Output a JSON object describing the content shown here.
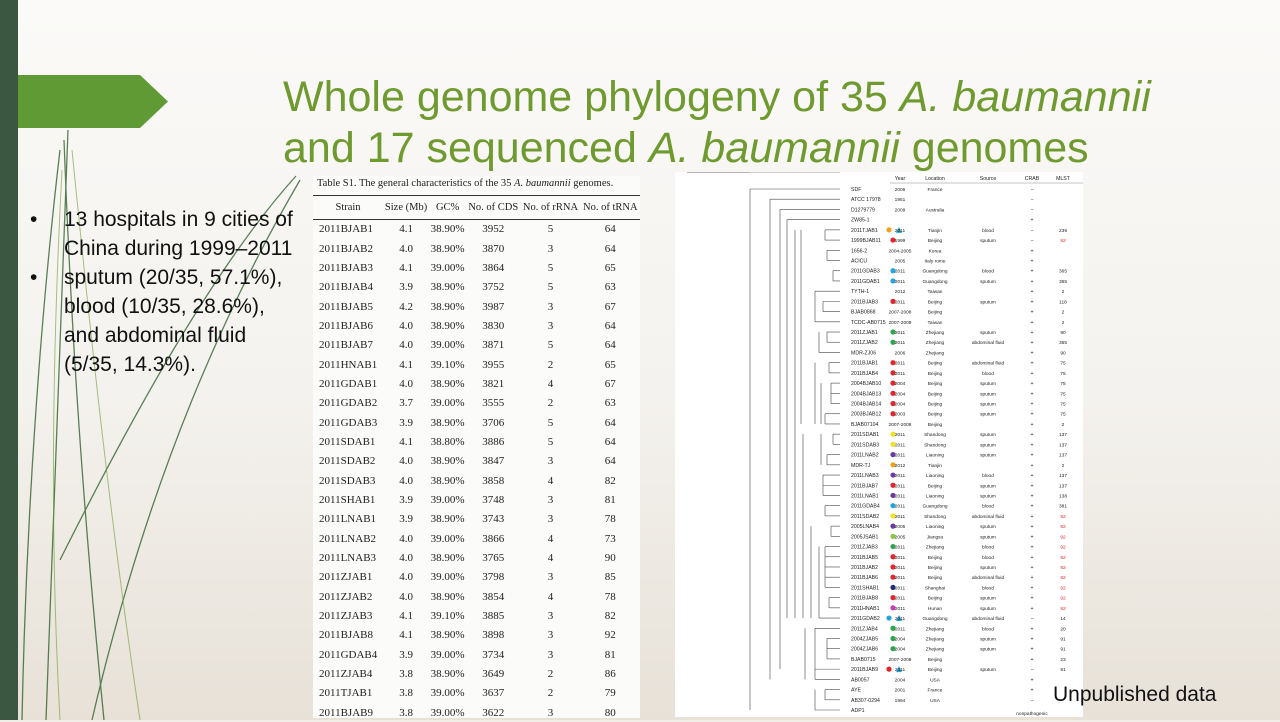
{
  "slide": {
    "title": {
      "line1_prefix": "Whole genome phylogeny of 35 ",
      "line1_genus": "A. ",
      "line1_species": "baumannii",
      "line2_prefix": "and 17 sequenced ",
      "line2_genus": "A. ",
      "line2_species": "baumannii",
      "line2_suffix": " genomes"
    },
    "bullets": [
      "13 hospitals in 9 cities of China during 1999–2011",
      "sputum (20/35, 57.1%), blood (10/35, 28.6%), and abdominal fluid (5/35, 14.3%)."
    ],
    "footnote": "Unpublished data",
    "colors": {
      "title": "#6f9a2f",
      "arrow": "#5f9a35",
      "sidebar": "#3b5742"
    }
  },
  "table": {
    "caption_prefix": "Table S1. The general characteristics of the 35 ",
    "caption_italic": "A. baumannii",
    "caption_suffix": " genomes.",
    "headers": [
      "Strain",
      "Size (Mb)",
      "GC%",
      "No. of CDS",
      "No. of rRNA",
      "No. of tRNA"
    ],
    "rows": [
      [
        "2011BJAB1",
        "4.1",
        "38.90%",
        "3952",
        "5",
        "64"
      ],
      [
        "2011BJAB2",
        "4.0",
        "38.90%",
        "3870",
        "3",
        "64"
      ],
      [
        "2011BJAB3",
        "4.1",
        "39.00%",
        "3864",
        "5",
        "65"
      ],
      [
        "2011BJAB4",
        "3.9",
        "38.90%",
        "3752",
        "5",
        "63"
      ],
      [
        "2011BJAB5",
        "4.2",
        "38.90%",
        "3987",
        "3",
        "67"
      ],
      [
        "2011BJAB6",
        "4.0",
        "38.90%",
        "3830",
        "3",
        "64"
      ],
      [
        "2011BJAB7",
        "4.0",
        "39.00%",
        "3871",
        "5",
        "64"
      ],
      [
        "2011HNAB1",
        "4.1",
        "39.10%",
        "3955",
        "2",
        "65"
      ],
      [
        "2011GDAB1",
        "4.0",
        "38.90%",
        "3821",
        "4",
        "67"
      ],
      [
        "2011GDAB2",
        "3.7",
        "39.00%",
        "3555",
        "2",
        "63"
      ],
      [
        "2011GDAB3",
        "3.9",
        "38.90%",
        "3706",
        "5",
        "64"
      ],
      [
        "2011SDAB1",
        "4.1",
        "38.80%",
        "3886",
        "5",
        "64"
      ],
      [
        "2011SDAB2",
        "4.0",
        "38.90%",
        "3847",
        "3",
        "64"
      ],
      [
        "2011SDAB3",
        "4.0",
        "38.90%",
        "3858",
        "4",
        "82"
      ],
      [
        "2011SHAB1",
        "3.9",
        "39.00%",
        "3748",
        "3",
        "81"
      ],
      [
        "2011LNAB1",
        "3.9",
        "38.90%",
        "3743",
        "3",
        "78"
      ],
      [
        "2011LNAB2",
        "4.0",
        "39.00%",
        "3866",
        "4",
        "73"
      ],
      [
        "2011LNAB3",
        "4.0",
        "38.90%",
        "3765",
        "4",
        "90"
      ],
      [
        "2011ZJAB1",
        "4.0",
        "39.00%",
        "3798",
        "3",
        "85"
      ],
      [
        "2011ZJAB2",
        "4.0",
        "38.90%",
        "3854",
        "4",
        "78"
      ],
      [
        "2011ZJAB3",
        "4.1",
        "39.10%",
        "3885",
        "3",
        "82"
      ],
      [
        "2011BJAB8",
        "4.1",
        "38.90%",
        "3898",
        "3",
        "92"
      ],
      [
        "2011GDAB4",
        "3.9",
        "39.00%",
        "3734",
        "3",
        "81"
      ],
      [
        "2011ZJAB4",
        "3.8",
        "38.90%",
        "3649",
        "2",
        "86"
      ],
      [
        "2011TJAB1",
        "3.8",
        "39.00%",
        "3637",
        "2",
        "79"
      ],
      [
        "2011BJAB9",
        "3.8",
        "39.00%",
        "3622",
        "3",
        "80"
      ]
    ]
  },
  "tree": {
    "headers": [
      "Year",
      "Location",
      "Source",
      "CRAB",
      "MLST"
    ],
    "footer_label": "nonpathogenic",
    "colors": {
      "red": "#e0262b",
      "blue": "#27a2dc",
      "green": "#2ea44b",
      "yellow": "#f2e022",
      "orange": "#f2a21a",
      "purple": "#6b3aa5",
      "navy": "#1f2a78",
      "magenta": "#c93bb8",
      "lime": "#8cc63f",
      "mlst_highlight": "#e0262b"
    },
    "leaves": [
      {
        "name": "SDF",
        "year": "2006",
        "loc": "France",
        "src": "",
        "crab": "−",
        "mlst": "",
        "dot": "",
        "tri": false
      },
      {
        "name": "ATCC 17978",
        "year": "1951",
        "loc": "",
        "src": "",
        "crab": "−",
        "mlst": "",
        "dot": "",
        "tri": false
      },
      {
        "name": "D1279779",
        "year": "2009",
        "loc": "Australia",
        "src": "",
        "crab": "−",
        "mlst": "",
        "dot": "",
        "tri": false
      },
      {
        "name": "ZW85-1",
        "year": "",
        "loc": "",
        "src": "",
        "crab": "+",
        "mlst": "",
        "dot": "",
        "tri": false
      },
      {
        "name": "2011TJAB1",
        "year": "2011",
        "loc": "Tianjin",
        "src": "blood",
        "crab": "−",
        "mlst": "239",
        "dot": "orange",
        "tri": true
      },
      {
        "name": "1999BJAB11",
        "year": "1999",
        "loc": "Beijing",
        "src": "sputum",
        "crab": "−",
        "mlst": "92",
        "dot": "red",
        "tri": false,
        "mlst_red": true
      },
      {
        "name": "1656-2",
        "year": "2004-2005",
        "loc": "Korea",
        "src": "",
        "crab": "+",
        "mlst": "",
        "dot": "",
        "tri": false
      },
      {
        "name": "ACICU",
        "year": "2005",
        "loc": "Italy rome",
        "src": "",
        "crab": "+",
        "mlst": "",
        "dot": "",
        "tri": false
      },
      {
        "name": "2011GDAB3",
        "year": "2011",
        "loc": "Guangdong",
        "src": "blood",
        "crab": "+",
        "mlst": "365",
        "dot": "blue",
        "tri": false
      },
      {
        "name": "2011GDAB1",
        "year": "2011",
        "loc": "Guangdong",
        "src": "sputum",
        "crab": "+",
        "mlst": "365",
        "dot": "blue",
        "tri": false
      },
      {
        "name": "TYTH-1",
        "year": "2012",
        "loc": "Taiwan",
        "src": "",
        "crab": "+",
        "mlst": "2",
        "dot": "",
        "tri": false
      },
      {
        "name": "2011BJAB3",
        "year": "2011",
        "loc": "Beijing",
        "src": "sputum",
        "crab": "+",
        "mlst": "118",
        "dot": "red",
        "tri": false
      },
      {
        "name": "BJAB0868",
        "year": "2007-2008",
        "loc": "Beijing",
        "src": "",
        "crab": "+",
        "mlst": "2",
        "dot": "",
        "tri": false
      },
      {
        "name": "TCDC-AB0715",
        "year": "2007-2009",
        "loc": "Taiwan",
        "src": "",
        "crab": "+",
        "mlst": "2",
        "dot": "",
        "tri": false
      },
      {
        "name": "2011ZJAB1",
        "year": "2011",
        "loc": "Zhejiang",
        "src": "sputum",
        "crab": "+",
        "mlst": "90",
        "dot": "green",
        "tri": false
      },
      {
        "name": "2011ZJAB2",
        "year": "2011",
        "loc": "Zhejiang",
        "src": "abdominal fluid",
        "crab": "+",
        "mlst": "365",
        "dot": "green",
        "tri": false
      },
      {
        "name": "MDR-ZJ06",
        "year": "2006",
        "loc": "Zhejiang",
        "src": "",
        "crab": "+",
        "mlst": "90",
        "dot": "",
        "tri": false
      },
      {
        "name": "2011BJAB1",
        "year": "2011",
        "loc": "Beijing",
        "src": "abdominal fluid",
        "crab": "+",
        "mlst": "75",
        "dot": "red",
        "tri": false
      },
      {
        "name": "2011BJAB4",
        "year": "2011",
        "loc": "Beijing",
        "src": "blood",
        "crab": "+",
        "mlst": "75",
        "dot": "red",
        "tri": false
      },
      {
        "name": "2004BJAB10",
        "year": "2004",
        "loc": "Beijing",
        "src": "sputum",
        "crab": "+",
        "mlst": "75",
        "dot": "red",
        "tri": false
      },
      {
        "name": "2004BJAB13",
        "year": "2004",
        "loc": "Beijing",
        "src": "sputum",
        "crab": "+",
        "mlst": "75",
        "dot": "red",
        "tri": false
      },
      {
        "name": "2004BJAB14",
        "year": "2004",
        "loc": "Beijing",
        "src": "sputum",
        "crab": "+",
        "mlst": "75",
        "dot": "red",
        "tri": false
      },
      {
        "name": "2003BJAB12",
        "year": "2003",
        "loc": "Beijing",
        "src": "sputum",
        "crab": "+",
        "mlst": "75",
        "dot": "red",
        "tri": false
      },
      {
        "name": "BJAB07104",
        "year": "2007-2008",
        "loc": "Beijing",
        "src": "",
        "crab": "+",
        "mlst": "2",
        "dot": "",
        "tri": false
      },
      {
        "name": "2011SDAB1",
        "year": "2011",
        "loc": "Shandong",
        "src": "sputum",
        "crab": "+",
        "mlst": "137",
        "dot": "yellow",
        "tri": false
      },
      {
        "name": "2011SDAB3",
        "year": "2011",
        "loc": "Shandong",
        "src": "sputum",
        "crab": "+",
        "mlst": "137",
        "dot": "yellow",
        "tri": false
      },
      {
        "name": "2011LNAB2",
        "year": "2011",
        "loc": "Liaoning",
        "src": "sputum",
        "crab": "+",
        "mlst": "137",
        "dot": "purple",
        "tri": false
      },
      {
        "name": "MDR-TJ",
        "year": "2012",
        "loc": "Tianjin",
        "src": "",
        "crab": "+",
        "mlst": "2",
        "dot": "orange",
        "tri": false
      },
      {
        "name": "2011LNAB3",
        "year": "2011",
        "loc": "Liaoning",
        "src": "blood",
        "crab": "+",
        "mlst": "137",
        "dot": "purple",
        "tri": false
      },
      {
        "name": "2011BJAB7",
        "year": "2011",
        "loc": "Beijing",
        "src": "sputum",
        "crab": "+",
        "mlst": "137",
        "dot": "red",
        "tri": false
      },
      {
        "name": "2011LNAB1",
        "year": "2011",
        "loc": "Liaoning",
        "src": "sputum",
        "crab": "+",
        "mlst": "138",
        "dot": "purple",
        "tri": false
      },
      {
        "name": "2011GDAB4",
        "year": "2011",
        "loc": "Guangdong",
        "src": "blood",
        "crab": "+",
        "mlst": "381",
        "dot": "blue",
        "tri": false
      },
      {
        "name": "2011SDAB2",
        "year": "2011",
        "loc": "Shandong",
        "src": "abdominal fluid",
        "crab": "+",
        "mlst": "92",
        "dot": "yellow",
        "tri": false,
        "mlst_red": true
      },
      {
        "name": "2005LNAB4",
        "year": "2005",
        "loc": "Liaoning",
        "src": "sputum",
        "crab": "+",
        "mlst": "92",
        "dot": "purple",
        "tri": false,
        "mlst_red": true
      },
      {
        "name": "2005JSAB1",
        "year": "2005",
        "loc": "Jiangsu",
        "src": "sputum",
        "crab": "+",
        "mlst": "92",
        "dot": "lime",
        "tri": false,
        "mlst_red": true
      },
      {
        "name": "2011ZJAB3",
        "year": "2011",
        "loc": "Zhejiang",
        "src": "blood",
        "crab": "+",
        "mlst": "92",
        "dot": "green",
        "tri": false,
        "mlst_red": true
      },
      {
        "name": "2011BJAB5",
        "year": "2011",
        "loc": "Beijing",
        "src": "blood",
        "crab": "+",
        "mlst": "92",
        "dot": "red",
        "tri": false,
        "mlst_red": true
      },
      {
        "name": "2011BJAB2",
        "year": "2011",
        "loc": "Beijing",
        "src": "sputum",
        "crab": "+",
        "mlst": "92",
        "dot": "red",
        "tri": false,
        "mlst_red": true
      },
      {
        "name": "2011BJAB6",
        "year": "2011",
        "loc": "Beijing",
        "src": "abdominal fluid",
        "crab": "+",
        "mlst": "92",
        "dot": "red",
        "tri": false,
        "mlst_red": true
      },
      {
        "name": "2011SHAB1",
        "year": "2011",
        "loc": "Shanghai",
        "src": "blood",
        "crab": "+",
        "mlst": "92",
        "dot": "navy",
        "tri": false,
        "mlst_red": true
      },
      {
        "name": "2011BJAB8",
        "year": "2011",
        "loc": "Beijing",
        "src": "sputum",
        "crab": "+",
        "mlst": "92",
        "dot": "red",
        "tri": false,
        "mlst_red": true
      },
      {
        "name": "2011HNAB1",
        "year": "2011",
        "loc": "Hunan",
        "src": "sputum",
        "crab": "+",
        "mlst": "92",
        "dot": "magenta",
        "tri": false,
        "mlst_red": true
      },
      {
        "name": "2011GDAB2",
        "year": "2011",
        "loc": "Guangdong",
        "src": "abdominal fluid",
        "crab": "−",
        "mlst": "14",
        "dot": "blue",
        "tri": true
      },
      {
        "name": "2011ZJAB4",
        "year": "2011",
        "loc": "Zhejiang",
        "src": "blood",
        "crab": "+",
        "mlst": "20",
        "dot": "green",
        "tri": false
      },
      {
        "name": "2004ZJAB5",
        "year": "2004",
        "loc": "Zhejiang",
        "src": "sputum",
        "crab": "+",
        "mlst": "91",
        "dot": "green",
        "tri": false
      },
      {
        "name": "2004ZJAB6",
        "year": "2004",
        "loc": "Zhejiang",
        "src": "sputum",
        "crab": "+",
        "mlst": "91",
        "dot": "green",
        "tri": false
      },
      {
        "name": "BJAB0715",
        "year": "2007-2008",
        "loc": "Beijing",
        "src": "",
        "crab": "+",
        "mlst": "23",
        "dot": "",
        "tri": false
      },
      {
        "name": "2011BJAB9",
        "year": "2011",
        "loc": "Beijing",
        "src": "sputum",
        "crab": "−",
        "mlst": "91",
        "dot": "red",
        "tri": true
      },
      {
        "name": "AB0057",
        "year": "2004",
        "loc": "USA",
        "src": "",
        "crab": "+",
        "mlst": "",
        "dot": "",
        "tri": false
      },
      {
        "name": "AYE",
        "year": "2001",
        "loc": "France",
        "src": "",
        "crab": "+",
        "mlst": "",
        "dot": "",
        "tri": false
      },
      {
        "name": "AB307-0294",
        "year": "1994",
        "loc": "USA",
        "src": "",
        "crab": "−",
        "mlst": "",
        "dot": "",
        "tri": false
      },
      {
        "name": "ADP1",
        "year": "",
        "loc": "",
        "src": "",
        "crab": "",
        "mlst": "",
        "dot": "",
        "tri": false
      }
    ]
  }
}
